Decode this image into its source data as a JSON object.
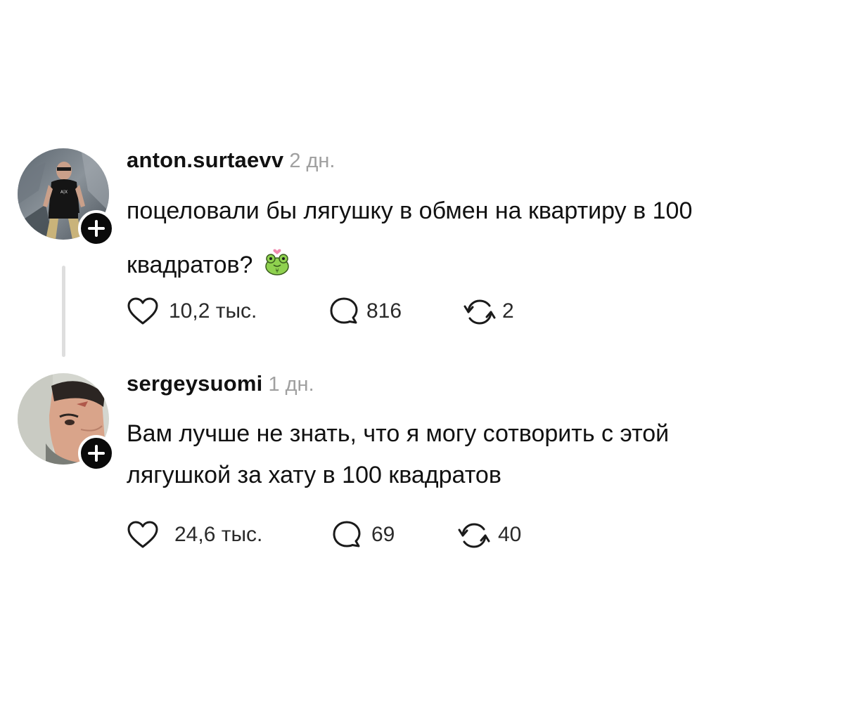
{
  "comments": [
    {
      "username": "anton.surtaevv",
      "time": "2 дн.",
      "text_lines": [
        "поцеловали бы лягушку в обмен на квартиру в 100",
        "квадратов?"
      ],
      "emoji": "frog-with-heart-emoji",
      "likes": "10,2 тыс.",
      "replies": "816",
      "reposts": "2"
    },
    {
      "username": "sergeysuomi",
      "time": "1 дн.",
      "text_lines": [
        "Вам лучше не знать, что я могу сотворить с этой",
        "лягушкой за хату в 100 квадратов"
      ],
      "likes": "24,6 тыс.",
      "replies": "69",
      "reposts": "40"
    }
  ],
  "icons": {
    "like": "heart-outline-icon",
    "reply": "speech-bubble-icon",
    "repost": "repost-arrows-icon",
    "follow": "plus-icon"
  },
  "colors": {
    "text": "#111111",
    "muted": "#a0a0a0",
    "badge": "#0a0a0a",
    "thread_line": "#dedede",
    "frog": "#8fd14f"
  }
}
